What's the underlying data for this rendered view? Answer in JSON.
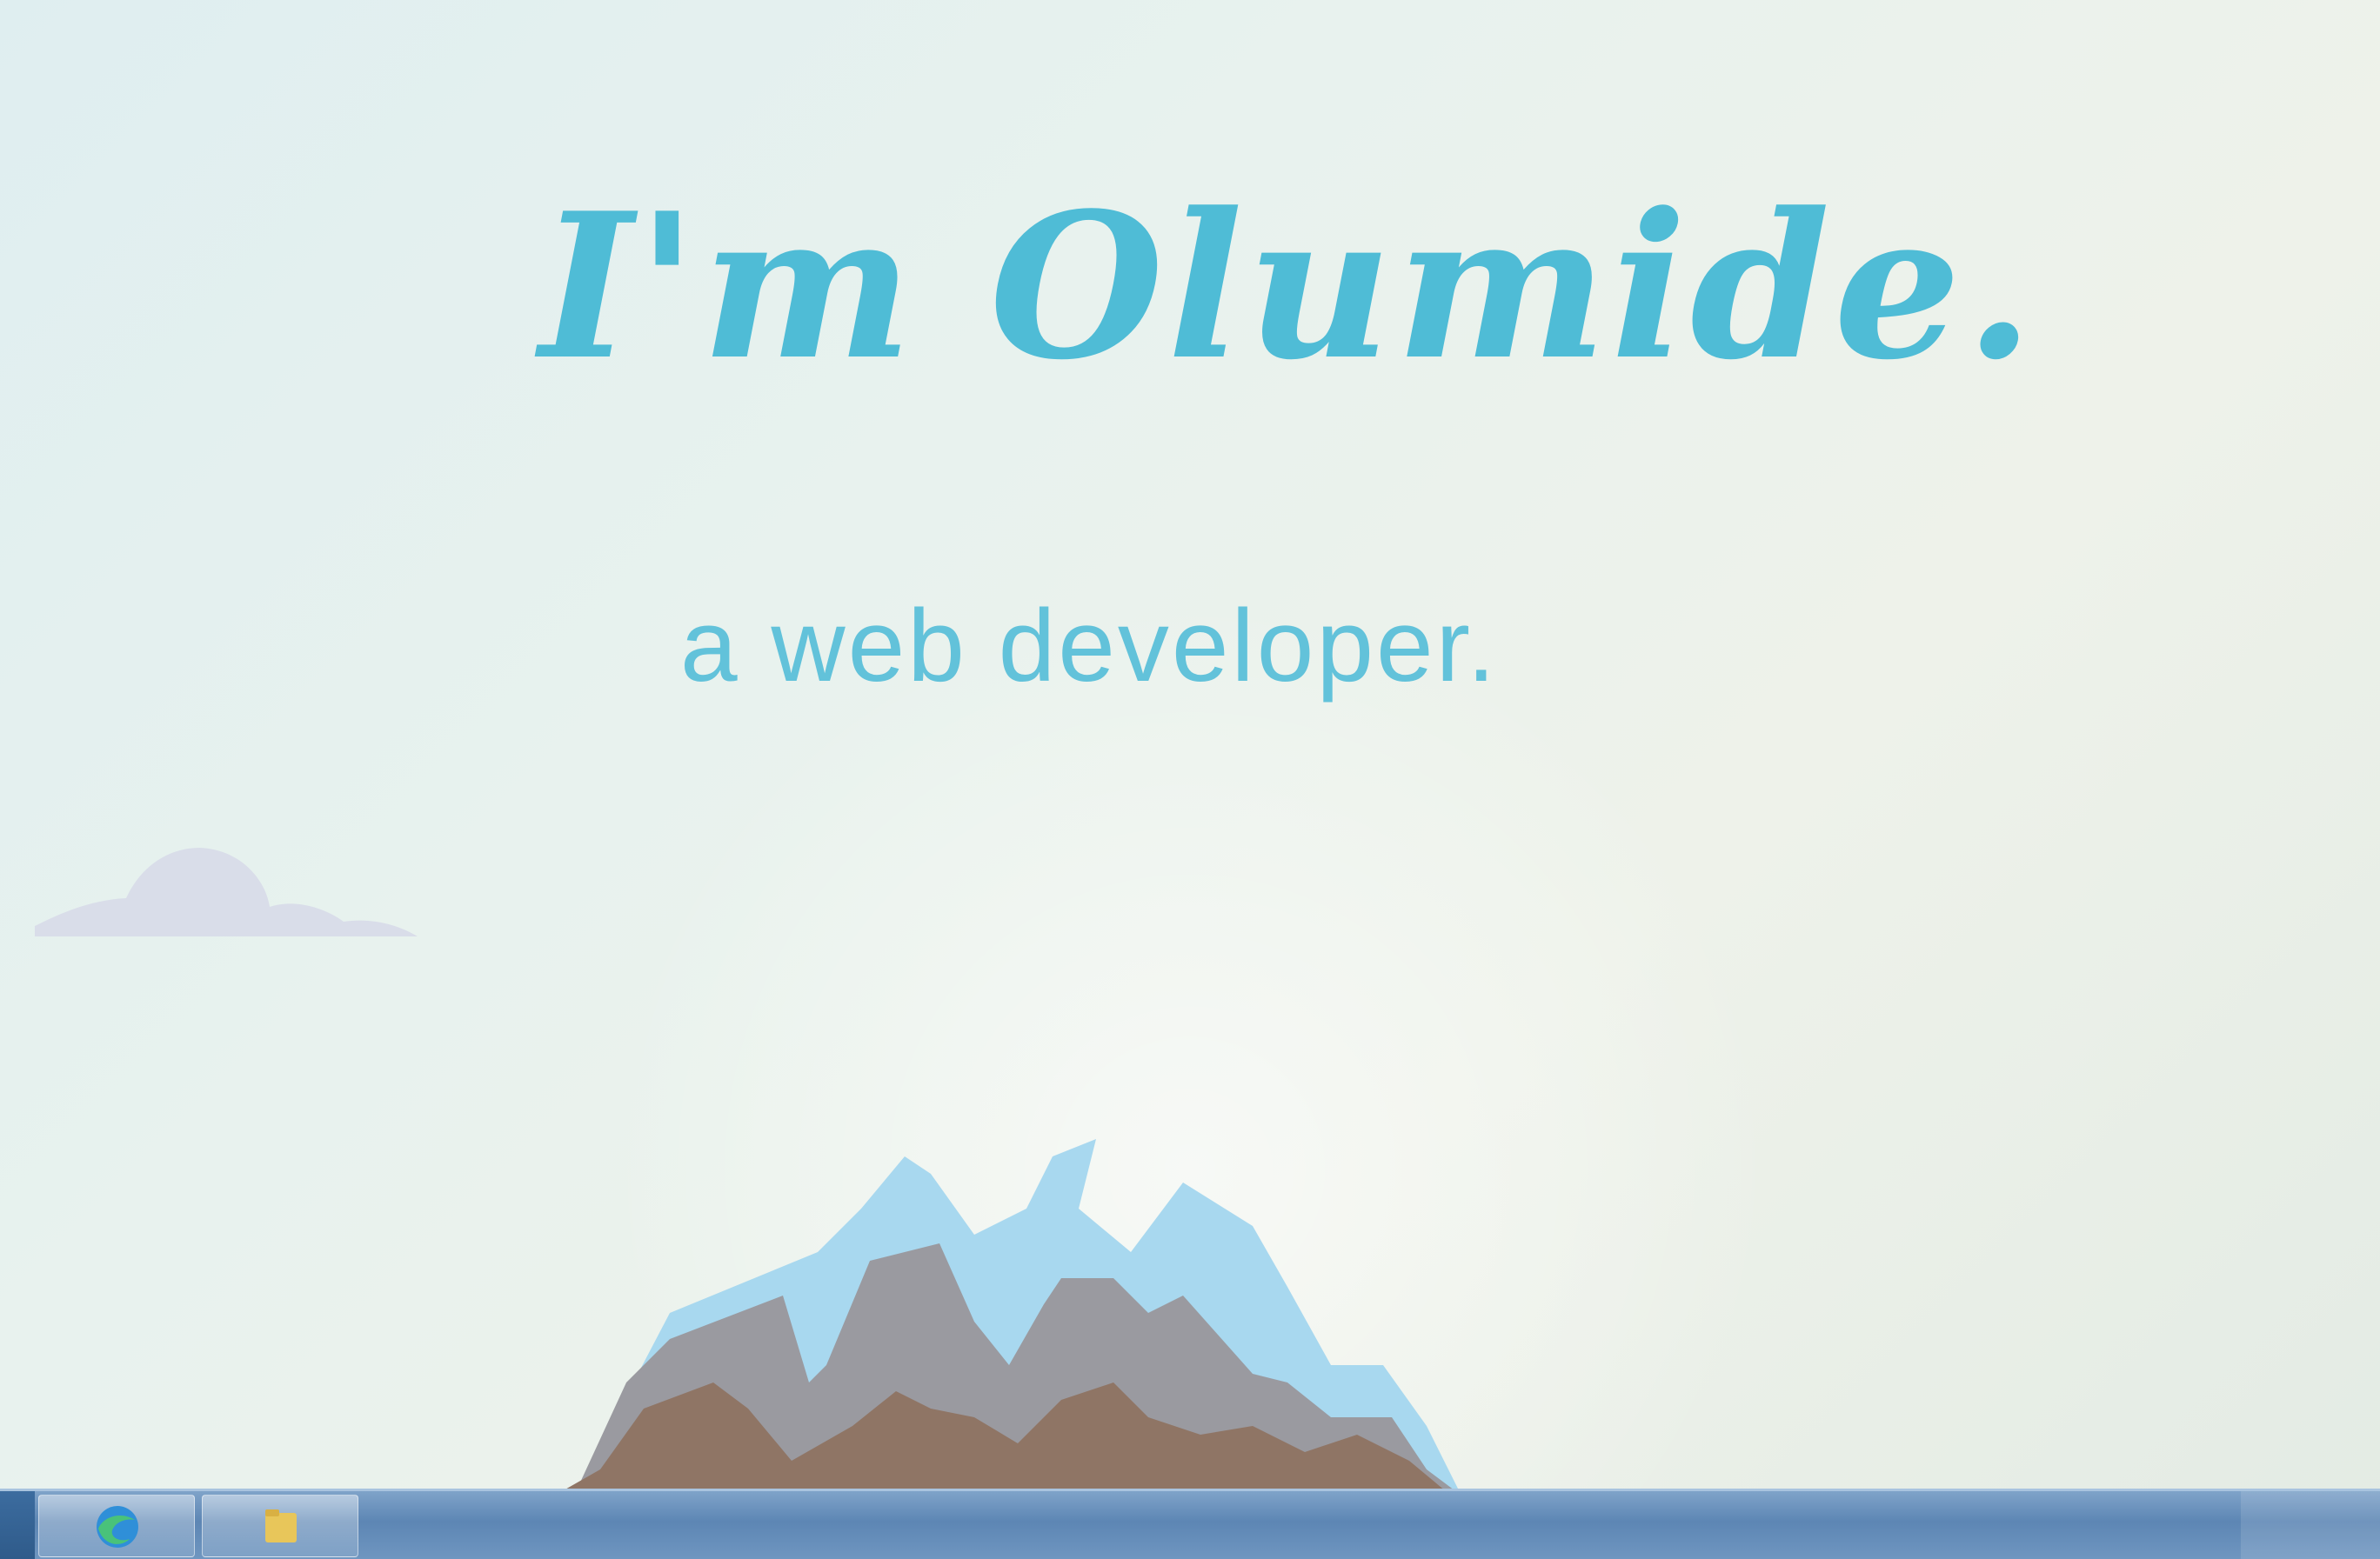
{
  "hero": {
    "title": "I'm Olumide.",
    "subtitle": "a web developer."
  },
  "colors": {
    "accent": "#4fbcd6",
    "cloud": "#d9dde9",
    "mountain_gray": "#9a9aa0",
    "mountain_brown": "#8f7565",
    "snow": "#a8d8ef",
    "grass": "#6cc08f"
  },
  "taskbar": {
    "buttons": [
      {
        "icon": "browser-icon"
      },
      {
        "icon": "file-explorer-icon"
      }
    ]
  }
}
